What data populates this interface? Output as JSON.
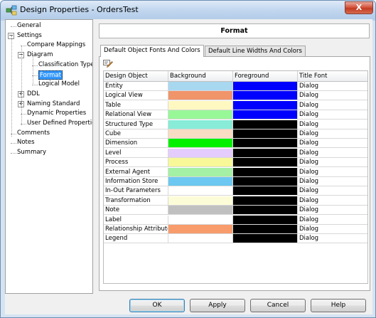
{
  "window": {
    "title": "Design Properties - OrdersTest",
    "close_label": "X"
  },
  "nav_tree": {
    "items": [
      {
        "label": "General",
        "level": 0,
        "expander": ""
      },
      {
        "label": "Settings",
        "level": 0,
        "expander": "-"
      },
      {
        "label": "Compare Mappings",
        "level": 1,
        "expander": ""
      },
      {
        "label": "Diagram",
        "level": 1,
        "expander": "-"
      },
      {
        "label": "Classification Type",
        "level": 2,
        "expander": ""
      },
      {
        "label": "Format",
        "level": 2,
        "expander": "",
        "selected": true
      },
      {
        "label": "Logical Model",
        "level": 2,
        "expander": ""
      },
      {
        "label": "DDL",
        "level": 1,
        "expander": "+"
      },
      {
        "label": "Naming Standard",
        "level": 1,
        "expander": "+"
      },
      {
        "label": "Dynamic Properties",
        "level": 1,
        "expander": ""
      },
      {
        "label": "User Defined Properties",
        "level": 1,
        "expander": ""
      },
      {
        "label": "Comments",
        "level": 0,
        "expander": ""
      },
      {
        "label": "Notes",
        "level": 0,
        "expander": ""
      },
      {
        "label": "Summary",
        "level": 0,
        "expander": ""
      }
    ]
  },
  "panel": {
    "header": "Format",
    "tabs": [
      {
        "label": "Default Object Fonts And Colors",
        "active": true
      },
      {
        "label": "Default Line Widths And Colors",
        "active": false
      }
    ]
  },
  "table": {
    "columns": [
      "Design Object",
      "Background",
      "Foreground",
      "Title Font"
    ],
    "rows": [
      {
        "object": "Entity",
        "background": "#a8d8f0",
        "foreground": "#0000ff",
        "font": "Dialog"
      },
      {
        "object": "Logical View",
        "background": "#f0946a",
        "foreground": "#0000ff",
        "font": "Dialog"
      },
      {
        "object": "Table",
        "background": "#fff8c0",
        "foreground": "#0000ff",
        "font": "Dialog"
      },
      {
        "object": "Relational View",
        "background": "#98f898",
        "foreground": "#0000ff",
        "font": "Dialog"
      },
      {
        "object": "Structured Type",
        "background": "#88ecd8",
        "foreground": "#000000",
        "font": "Dialog"
      },
      {
        "object": "Cube",
        "background": "#f8dcc4",
        "foreground": "#000000",
        "font": "Dialog"
      },
      {
        "object": "Dimension",
        "background": "#00f000",
        "foreground": "#000000",
        "font": "Dialog"
      },
      {
        "object": "Level",
        "background": "#e4ccfc",
        "foreground": "#000000",
        "font": "Dialog"
      },
      {
        "object": "Process",
        "background": "#f8f898",
        "foreground": "#000000",
        "font": "Dialog"
      },
      {
        "object": "External Agent",
        "background": "#a4f0a4",
        "foreground": "#000000",
        "font": "Dialog"
      },
      {
        "object": "Information Store",
        "background": "#6cc8f0",
        "foreground": "#000000",
        "font": "Dialog"
      },
      {
        "object": "In-Out Parameters",
        "background": "#ffffff",
        "foreground": "#000000",
        "font": "Dialog"
      },
      {
        "object": "Transformation",
        "background": "#fcfcd8",
        "foreground": "#000000",
        "font": "Dialog"
      },
      {
        "object": "Note",
        "background": "#c0c0c0",
        "foreground": "#000000",
        "font": "Dialog"
      },
      {
        "object": "Label",
        "background": "#ffffff",
        "foreground": "#000000",
        "font": "Dialog"
      },
      {
        "object": "Relationship Attributes",
        "background": "#f89c6c",
        "foreground": "#000000",
        "font": "Dialog"
      },
      {
        "object": "Legend",
        "background": "#ffffff",
        "foreground": "#000000",
        "font": "Dialog"
      }
    ]
  },
  "buttons": {
    "ok": "OK",
    "apply": "Apply",
    "cancel": "Cancel",
    "help": "Help"
  },
  "icons": {
    "app": "design-properties-icon",
    "edit": "pencil-edit-icon"
  }
}
